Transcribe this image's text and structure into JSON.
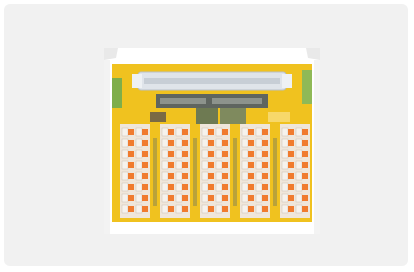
{
  "image": {
    "subject": "interface-module-terminal-block",
    "colors": {
      "board": "#f0c21f",
      "frame": "#ffffff",
      "connector": "#dfe4ea",
      "terminal-orange": "#f07b2e",
      "lever-white": "#f6f2ec",
      "panel-gray": "#5f655f",
      "green-strip": "#7fae4a",
      "background": "#f1f1f1"
    },
    "terminal_blocks": 5,
    "terminals_per_block": 8
  }
}
